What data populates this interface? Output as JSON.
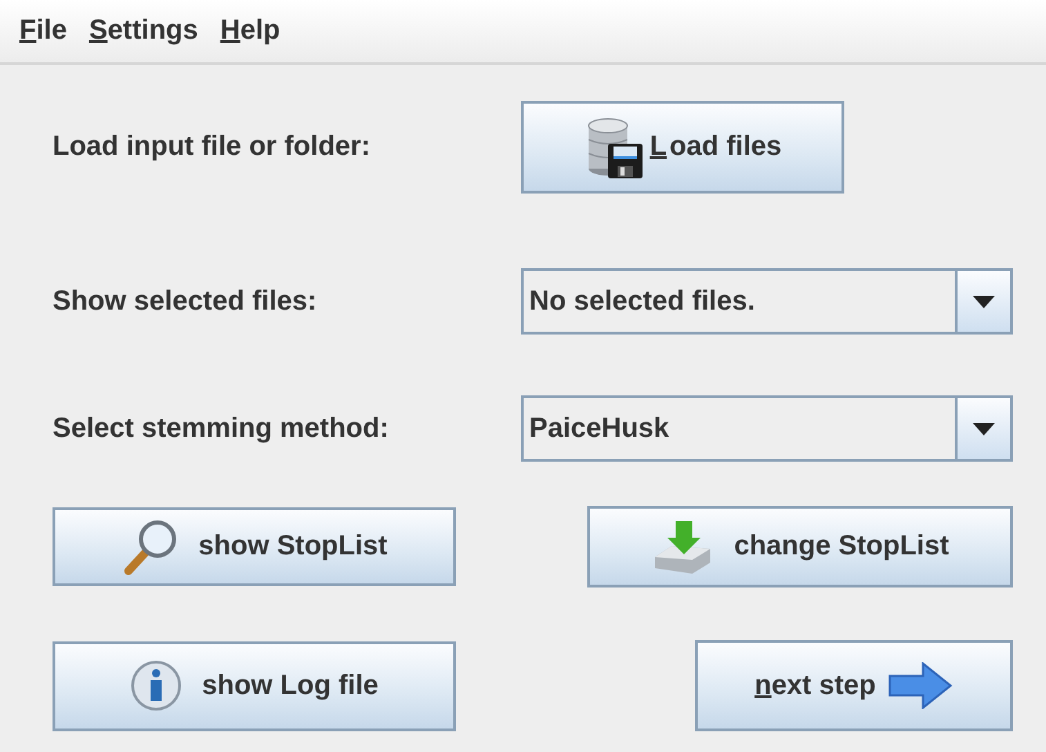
{
  "menu": [
    {
      "label": "File",
      "underline_first": true
    },
    {
      "label": "Settings",
      "underline_first": true
    },
    {
      "label": "Help",
      "underline_first": true
    }
  ],
  "rows": [
    {
      "kind": "button",
      "label": "Load input file or folder:",
      "control": {
        "label": "Load files",
        "kind": "database",
        "underline_first": true
      }
    },
    {
      "kind": "combo",
      "label": "Show selected files:",
      "control": {
        "value": "No selected files."
      }
    },
    {
      "kind": "combo",
      "label": "Select stemming method:",
      "control": {
        "value": "PaiceHusk"
      }
    }
  ],
  "actions": [
    [
      {
        "label": "show StopList",
        "kind": "magnifier",
        "underline_first": false
      },
      {
        "label": "change StopList",
        "kind": "tray",
        "underline_first": false
      }
    ],
    [
      {
        "label": "show Log file",
        "kind": "info",
        "underline_first": false
      },
      {
        "label": "next step",
        "kind": "arrow",
        "underline_first": true
      }
    ]
  ]
}
